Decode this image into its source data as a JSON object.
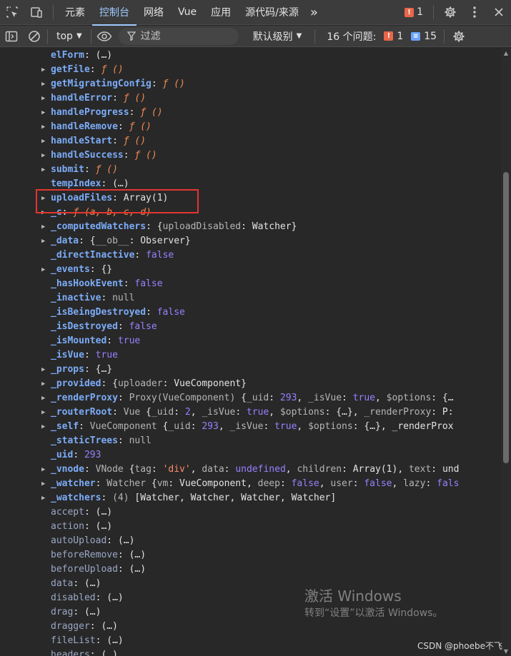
{
  "tabs": {
    "elements": "元素",
    "console": "控制台",
    "network": "网络",
    "vue": "Vue",
    "application": "应用",
    "sources": "源代码/来源",
    "more": "»",
    "error_count": "1"
  },
  "toolbar": {
    "context": "top",
    "filter_placeholder": "过滤",
    "level": "默认级别",
    "issues_label": "16 个问题:",
    "issues_errors": "1",
    "issues_info": "15"
  },
  "tree": [
    {
      "indent": 0,
      "name": "elForm",
      "value": "(…)",
      "kind": "lazy",
      "bold": true
    },
    {
      "indent": 1,
      "name": "getFile",
      "value": "ƒ ()",
      "kind": "fn",
      "bold": true
    },
    {
      "indent": 1,
      "name": "getMigratingConfig",
      "value": "ƒ ()",
      "kind": "fn",
      "bold": true
    },
    {
      "indent": 1,
      "name": "handleError",
      "value": "ƒ ()",
      "kind": "fn",
      "bold": true
    },
    {
      "indent": 1,
      "name": "handleProgress",
      "value": "ƒ ()",
      "kind": "fn",
      "bold": true
    },
    {
      "indent": 1,
      "name": "handleRemove",
      "value": "ƒ ()",
      "kind": "fn",
      "bold": true
    },
    {
      "indent": 1,
      "name": "handleStart",
      "value": "ƒ ()",
      "kind": "fn",
      "bold": true
    },
    {
      "indent": 1,
      "name": "handleSuccess",
      "value": "ƒ ()",
      "kind": "fn",
      "bold": true
    },
    {
      "indent": 1,
      "name": "submit",
      "value": "ƒ ()",
      "kind": "fn",
      "bold": true
    },
    {
      "indent": 0,
      "name": "tempIndex",
      "value": "(…)",
      "kind": "lazy",
      "bold": true
    },
    {
      "indent": 1,
      "name": "uploadFiles",
      "value": "Array(1)",
      "kind": "plain",
      "bold": true
    },
    {
      "indent": 1,
      "name": "_c",
      "value": "ƒ (a, b, c, d)",
      "kind": "fn",
      "bold": true
    },
    {
      "indent": 1,
      "name": "_computedWatchers",
      "value": "{uploadDisabled: Watcher}",
      "kind": "obj",
      "bold": true
    },
    {
      "indent": 1,
      "name": "_data",
      "value": "{__ob__: Observer}",
      "kind": "obj",
      "bold": true
    },
    {
      "indent": 0,
      "name": "_directInactive",
      "value": "false",
      "kind": "kw",
      "bold": true
    },
    {
      "indent": 1,
      "name": "_events",
      "value": "{}",
      "kind": "plain",
      "bold": true
    },
    {
      "indent": 0,
      "name": "_hasHookEvent",
      "value": "false",
      "kind": "kw",
      "bold": true
    },
    {
      "indent": 0,
      "name": "_inactive",
      "value": "null",
      "kind": "null",
      "bold": true
    },
    {
      "indent": 0,
      "name": "_isBeingDestroyed",
      "value": "false",
      "kind": "kw",
      "bold": true
    },
    {
      "indent": 0,
      "name": "_isDestroyed",
      "value": "false",
      "kind": "kw",
      "bold": true
    },
    {
      "indent": 0,
      "name": "_isMounted",
      "value": "true",
      "kind": "kw",
      "bold": true
    },
    {
      "indent": 0,
      "name": "_isVue",
      "value": "true",
      "kind": "kw",
      "bold": true
    },
    {
      "indent": 1,
      "name": "_props",
      "value": "{…}",
      "kind": "plain",
      "bold": true
    },
    {
      "indent": 1,
      "name": "_provided",
      "value": "{uploader: VueComponent}",
      "kind": "obj",
      "bold": true
    },
    {
      "indent": 1,
      "name": "_renderProxy",
      "value": "Proxy(VueComponent)  {_uid: 293, _isVue: true, $options: {…",
      "kind": "obj",
      "bold": true
    },
    {
      "indent": 1,
      "name": "_routerRoot",
      "value": "Vue  {_uid: 2, _isVue: true, $options: {…}, _renderProxy: P:",
      "kind": "obj",
      "bold": true
    },
    {
      "indent": 1,
      "name": "_self",
      "value": "VueComponent  {_uid: 293, _isVue: true, $options: {…}, _renderProx",
      "kind": "obj",
      "bold": true
    },
    {
      "indent": 0,
      "name": "_staticTrees",
      "value": "null",
      "kind": "null",
      "bold": true
    },
    {
      "indent": 0,
      "name": "_uid",
      "value": "293",
      "kind": "num",
      "bold": true
    },
    {
      "indent": 1,
      "name": "_vnode",
      "value": "VNode  {tag: 'div', data: undefined, children: Array(1), text: und",
      "kind": "obj",
      "bold": true
    },
    {
      "indent": 1,
      "name": "_watcher",
      "value": "Watcher  {vm: VueComponent, deep: false, user: false, lazy: fals",
      "kind": "obj",
      "bold": true
    },
    {
      "indent": 1,
      "name": "_watchers",
      "value": "(4)  [Watcher, Watcher, Watcher, Watcher]",
      "kind": "obj",
      "bold": true
    },
    {
      "indent": 0,
      "name": "accept",
      "value": "(…)",
      "kind": "lazy",
      "bold": false
    },
    {
      "indent": 0,
      "name": "action",
      "value": "(…)",
      "kind": "lazy",
      "bold": false
    },
    {
      "indent": 0,
      "name": "autoUpload",
      "value": "(…)",
      "kind": "lazy",
      "bold": false
    },
    {
      "indent": 0,
      "name": "beforeRemove",
      "value": "(…)",
      "kind": "lazy",
      "bold": false
    },
    {
      "indent": 0,
      "name": "beforeUpload",
      "value": "(…)",
      "kind": "lazy",
      "bold": false
    },
    {
      "indent": 0,
      "name": "data",
      "value": "(…)",
      "kind": "lazy",
      "bold": false
    },
    {
      "indent": 0,
      "name": "disabled",
      "value": "(…)",
      "kind": "lazy",
      "bold": false
    },
    {
      "indent": 0,
      "name": "drag",
      "value": "(…)",
      "kind": "lazy",
      "bold": false
    },
    {
      "indent": 0,
      "name": "dragger",
      "value": "(…)",
      "kind": "lazy",
      "bold": false
    },
    {
      "indent": 0,
      "name": "fileList",
      "value": "(…)",
      "kind": "lazy",
      "bold": false
    },
    {
      "indent": 0,
      "name": "headers",
      "value": "(…)",
      "kind": "lazy",
      "bold": false
    }
  ],
  "activation": {
    "title": "激活 Windows",
    "subtitle": "转到“设置”以激活 Windows。"
  },
  "watermark": "CSDN @phoebe不飞",
  "colors": {
    "accent": "#9ecaff",
    "highlight_box": "#e5352f",
    "error_badge": "#e8664a",
    "info_badge": "#6ba3ff"
  }
}
